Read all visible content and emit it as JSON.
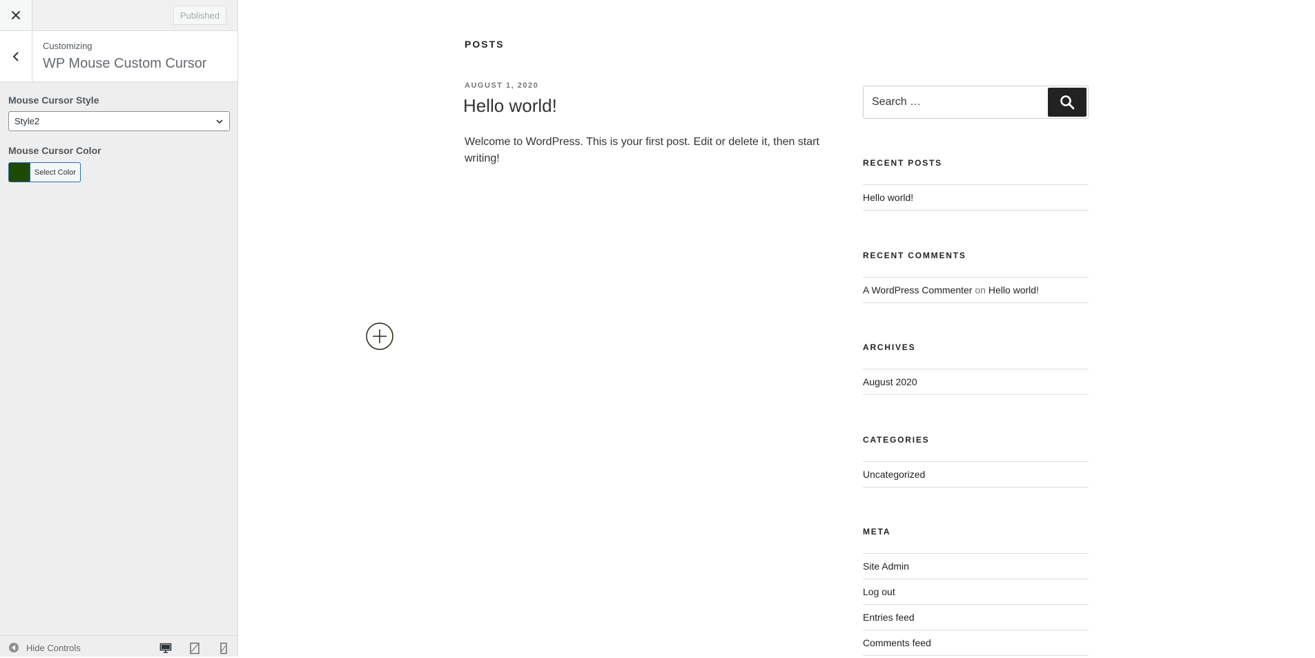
{
  "customizer": {
    "published_label": "Published",
    "breadcrumb": "Customizing",
    "section_title": "WP Mouse Custom Cursor",
    "cursor_style": {
      "label": "Mouse Cursor Style",
      "selected": "Style2"
    },
    "cursor_color": {
      "label": "Mouse Cursor Color",
      "button_label": "Select Color",
      "value": "#1e4a00"
    },
    "footer": {
      "hide_controls_label": "Hide Controls"
    }
  },
  "preview": {
    "posts_heading": "POSTS",
    "post": {
      "date": "AUGUST 1, 2020",
      "title": "Hello world!",
      "body": "Welcome to WordPress. This is your first post. Edit or delete it, then start writing!"
    },
    "search": {
      "placeholder": "Search …"
    },
    "recent_posts": {
      "title": "RECENT POSTS",
      "items": [
        "Hello world!"
      ]
    },
    "recent_comments": {
      "title": "RECENT COMMENTS",
      "author": "A WordPress Commenter",
      "sep": "on",
      "post": "Hello world!"
    },
    "archives": {
      "title": "ARCHIVES",
      "items": [
        "August 2020"
      ]
    },
    "categories": {
      "title": "CATEGORIES",
      "items": [
        "Uncategorized"
      ]
    },
    "meta": {
      "title": "META",
      "items": [
        "Site Admin",
        "Log out",
        "Entries feed",
        "Comments feed"
      ]
    }
  },
  "colors": {
    "cursor_ring": "#1e2a10",
    "accent": "#2271b1"
  }
}
